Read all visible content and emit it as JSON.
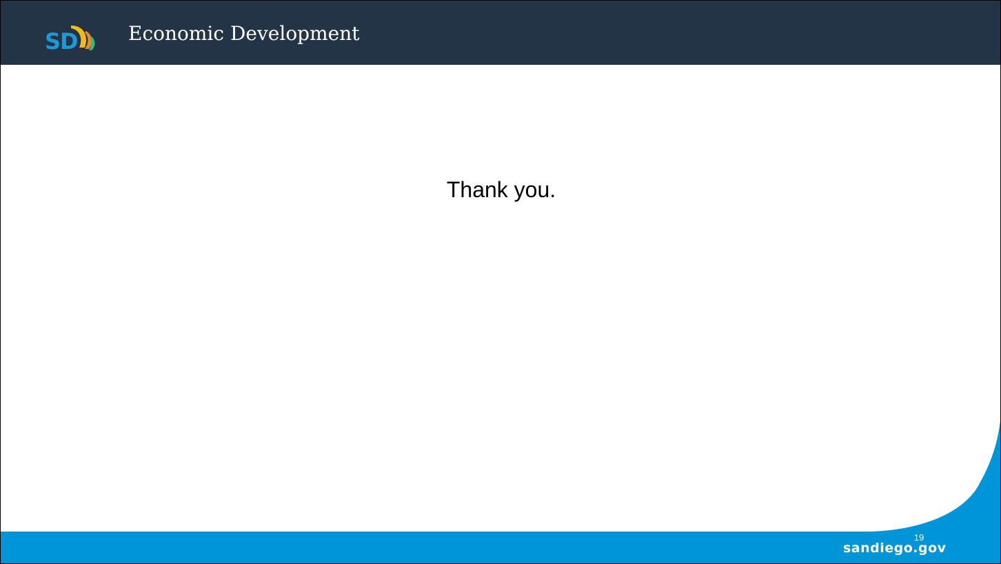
{
  "header": {
    "logo_text": "SD",
    "title": "Economic Development"
  },
  "body": {
    "text": "Thank you."
  },
  "footer": {
    "page_number": "19",
    "site": "sandiego.gov"
  },
  "colors": {
    "header_bg": "#243447",
    "footer_blue": "#0095d9",
    "logo_blue": "#1d9ad6",
    "logo_yellow": "#f6b91a",
    "logo_orange": "#f08a24",
    "text": "#000000"
  }
}
